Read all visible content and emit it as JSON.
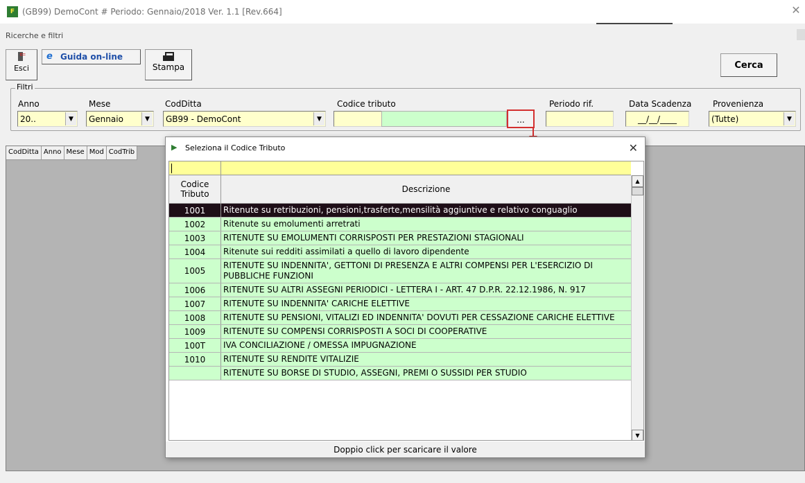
{
  "window": {
    "title": "(GB99) DemoCont  # Periodo: Gennaio/2018 Ver. 1.1 [Rev.664]",
    "close_glyph": "✕"
  },
  "panel": {
    "title": "Ricerche e filtri"
  },
  "toolbar": {
    "esci_label": "Esci",
    "guida_label": "Guida on-line",
    "stampa_label": "Stampa",
    "cerca_label": "Cerca"
  },
  "filters": {
    "group_label": "Filtri",
    "anno": {
      "label": "Anno",
      "value": "20.."
    },
    "mese": {
      "label": "Mese",
      "value": "Gennaio"
    },
    "codditta": {
      "label": "CodDitta",
      "value": "GB99 - DemoCont"
    },
    "codice_tributo": {
      "label": "Codice tributo",
      "value": "",
      "lookup_label": "..."
    },
    "periodo_rif": {
      "label": "Periodo rif.",
      "value": ""
    },
    "data_scadenza": {
      "label": "Data Scadenza",
      "value": "__/__/____"
    },
    "provenienza": {
      "label": "Provenienza",
      "value": "(Tutte)"
    }
  },
  "grid": {
    "columns": [
      "CodDitta",
      "Anno",
      "Mese",
      "Mod",
      "CodTrib"
    ]
  },
  "dialog": {
    "title": "Seleziona il Codice Tributo",
    "close_glyph": "✕",
    "filter_value": "",
    "col_code_line1": "Codice",
    "col_code_line2": "Tributo",
    "col_desc": "Descrizione",
    "rows": [
      {
        "code": "1001",
        "desc": "Ritenute su retribuzioni, pensioni,trasferte,mensilità aggiuntive e relativo conguaglio"
      },
      {
        "code": "1002",
        "desc": "Ritenute su emolumenti arretrati"
      },
      {
        "code": "1003",
        "desc": "RITENUTE SU EMOLUMENTI CORRISPOSTI PER PRESTAZIONI STAGIONALI"
      },
      {
        "code": "1004",
        "desc": "Ritenute sui redditi assimilati a quello di lavoro dipendente"
      },
      {
        "code": "1005",
        "desc": "RITENUTE SU INDENNITA', GETTONI DI PRESENZA E ALTRI COMPENSI PER L'ESERCIZIO DI PUBBLICHE FUNZIONI"
      },
      {
        "code": "1006",
        "desc": "RITENUTE SU ALTRI ASSEGNI PERIODICI - LETTERA I - ART. 47 D.P.R. 22.12.1986, N. 917"
      },
      {
        "code": "1007",
        "desc": "RITENUTE SU INDENNITA' CARICHE ELETTIVE"
      },
      {
        "code": "1008",
        "desc": "RITENUTE SU PENSIONI, VITALIZI ED INDENNITA' DOVUTI PER CESSAZIONE CARICHE ELETTIVE"
      },
      {
        "code": "1009",
        "desc": "RITENUTE SU COMPENSI CORRISPOSTI A SOCI DI COOPERATIVE"
      },
      {
        "code": "100T",
        "desc": "IVA CONCILIAZIONE /  OMESSA IMPUGNAZIONE"
      },
      {
        "code": "1010",
        "desc": "RITENUTE SU RENDITE VITALIZIE"
      },
      {
        "code": "",
        "desc": "RITENUTE SU BORSE DI STUDIO, ASSEGNI, PREMI O SUSSIDI PER STUDIO"
      }
    ],
    "selected_code": "1001",
    "status": "Doppio click per scaricare il valore"
  },
  "colors": {
    "input_yellow": "#ffffcc",
    "row_green": "#ccffcc",
    "selected_row": "#1e0e17",
    "highlight_red": "#d32f2f"
  }
}
